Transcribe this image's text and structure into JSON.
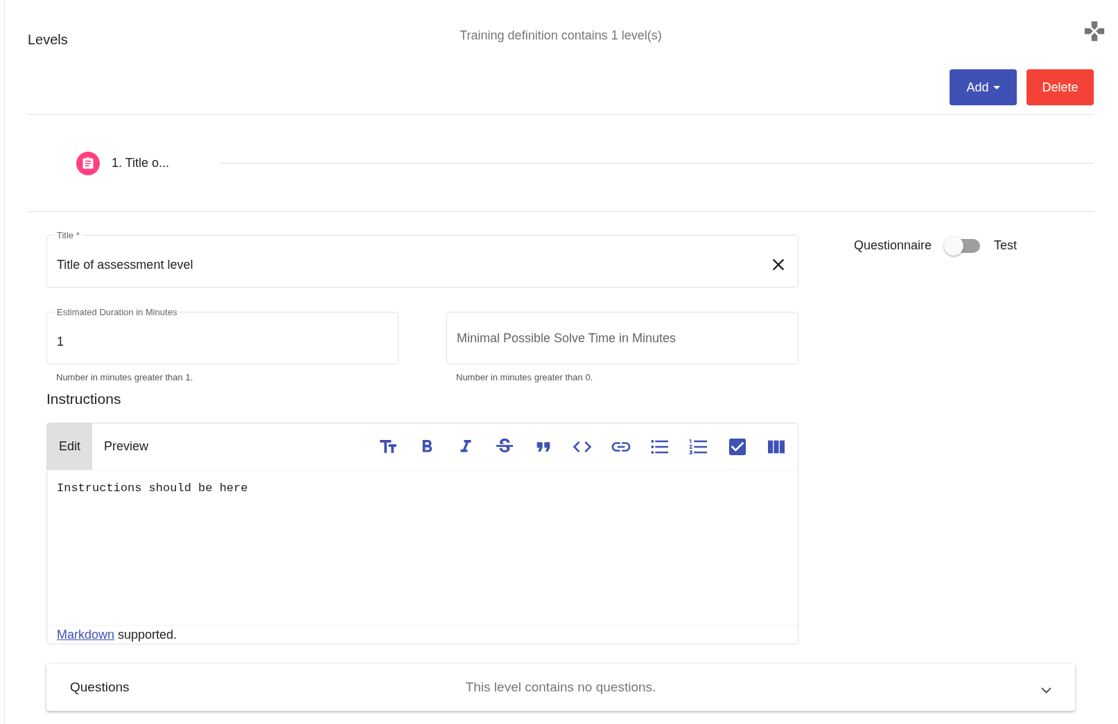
{
  "header": {
    "title": "Levels",
    "summary": "Training definition contains 1 level(s)"
  },
  "actions": [
    {
      "label": "Add",
      "kind": "dropdown"
    },
    {
      "label": "Delete",
      "kind": "danger"
    }
  ],
  "stepper": [
    {
      "label": "1. Title o...",
      "selected": true
    }
  ],
  "form": {
    "title": {
      "label": "Title *",
      "value": "Title of assessment level"
    },
    "type_toggle": {
      "left": "Questionnaire",
      "right": "Test",
      "on": false
    },
    "duration": {
      "label": "Estimated Duration in Minutes",
      "value": "1",
      "hint": "Number in minutes greater than 1."
    },
    "min_time": {
      "placeholder": "Minimal Possible Solve Time in Minutes",
      "hint": "Number in minutes greater than 0."
    }
  },
  "instructions": {
    "heading": "Instructions",
    "tabs": [
      {
        "label": "Edit",
        "selected": true
      },
      {
        "label": "Preview",
        "selected": false
      }
    ],
    "text": "Instructions should be here",
    "footer_link": "Markdown",
    "footer_text": "supported."
  },
  "questions": {
    "title": "Questions",
    "summary": "This level contains no questions.",
    "expanded": false
  }
}
